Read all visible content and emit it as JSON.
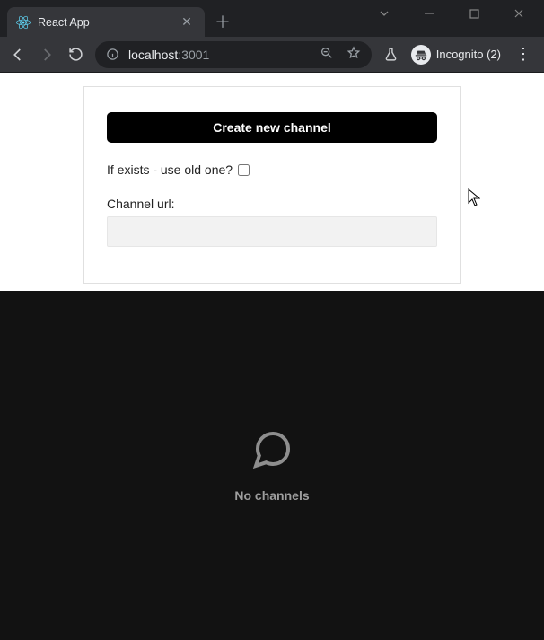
{
  "browser": {
    "tab_title": "React App",
    "url_host": "localhost",
    "url_port": ":3001",
    "incognito_label": "Incognito (2)"
  },
  "panel": {
    "create_button_label": "Create new channel",
    "exists_label": "If exists - use old one?",
    "exists_checked": false,
    "url_label": "Channel url:",
    "url_value": ""
  },
  "chat": {
    "empty_label": "No channels"
  }
}
